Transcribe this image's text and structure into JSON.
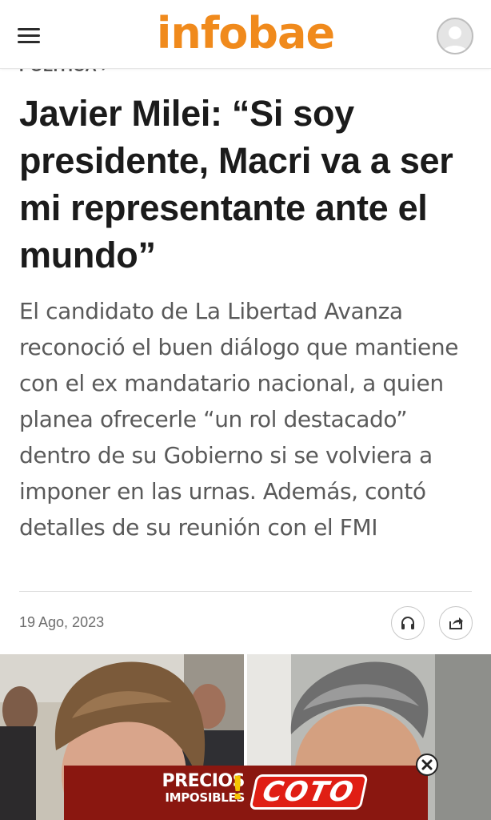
{
  "header": {
    "logo_text": "infobae",
    "menu_icon": "hamburger-menu-icon",
    "account_icon": "user-avatar-icon"
  },
  "article": {
    "section": "POLÍTICA ›",
    "headline": "Javier Milei: “Si soy presidente, Macri va a ser mi representante ante el mundo”",
    "summary": "El candidato de La Libertad Avanza reconoció el buen diálogo que mantiene con el ex mandatario nacional, a quien planea ofrecerle “un rol destacado” dentro de su Gobierno si se volviera a imponer en las urnas. Además, contó detalles de su reunión con el FMI",
    "date": "19 Ago, 2023"
  },
  "actions": {
    "audio_icon": "headphones-icon",
    "share_icon": "share-icon"
  },
  "ad": {
    "precios_line1": "PRECIOS",
    "precios_line2": "IMPOSIBLES",
    "exclamation": "!",
    "brand": "COTO",
    "close_icon": "close-icon"
  },
  "colors": {
    "brand_orange": "#f08a1c",
    "ad_background": "#8a1710",
    "ad_logo_red": "#e01e14",
    "ad_accent_yellow": "#f5c400"
  }
}
